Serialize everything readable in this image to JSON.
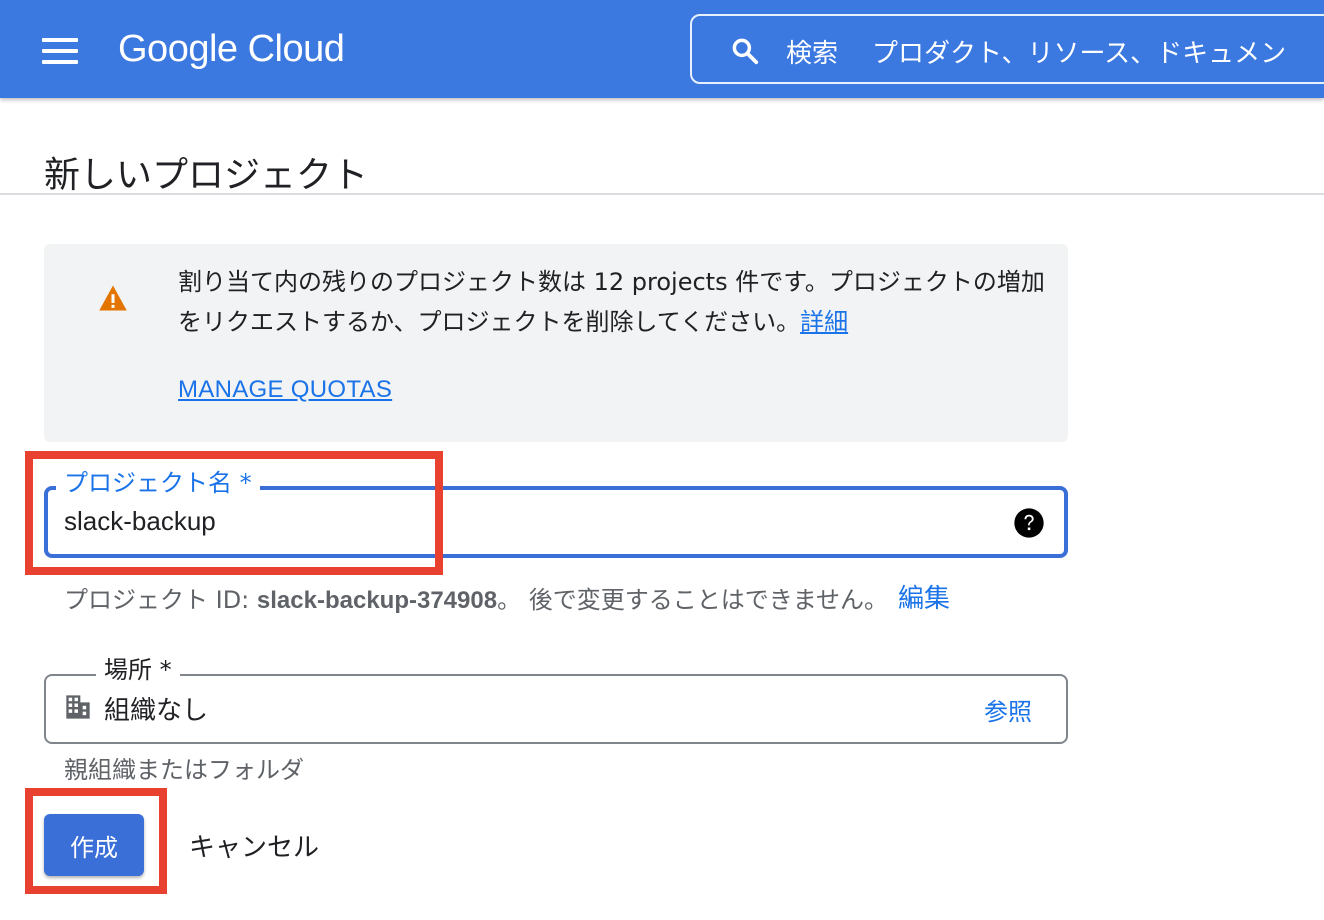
{
  "header": {
    "logo_text": "Google Cloud",
    "search_label": "検索",
    "search_placeholder": "プロダクト、リソース、ドキュメン"
  },
  "page": {
    "title": "新しいプロジェクト"
  },
  "notice": {
    "text_part1": "割り当て内の残りのプロジェクト数は 12 projects 件です。プロジェクトの増加をリクエストするか、プロジェクトを削除してください。",
    "details_link": "詳細",
    "manage_quotas_link": "MANAGE QUOTAS"
  },
  "project_name": {
    "label": "プロジェクト名 *",
    "value": "slack-backup"
  },
  "project_id": {
    "prefix": "プロジェクト ID: ",
    "id": "slack-backup-374908",
    "suffix": "。 後で変更することはできません。",
    "edit_link": "編集"
  },
  "location": {
    "label": "場所 *",
    "value": "組織なし",
    "browse_link": "参照",
    "helper": "親組織またはフォルダ"
  },
  "actions": {
    "create_label": "作成",
    "cancel_label": "キャンセル"
  },
  "colors": {
    "header_bg": "#3b78e0",
    "accent": "#1a73e8",
    "highlight": "#e8412f",
    "warning": "#e37400"
  }
}
